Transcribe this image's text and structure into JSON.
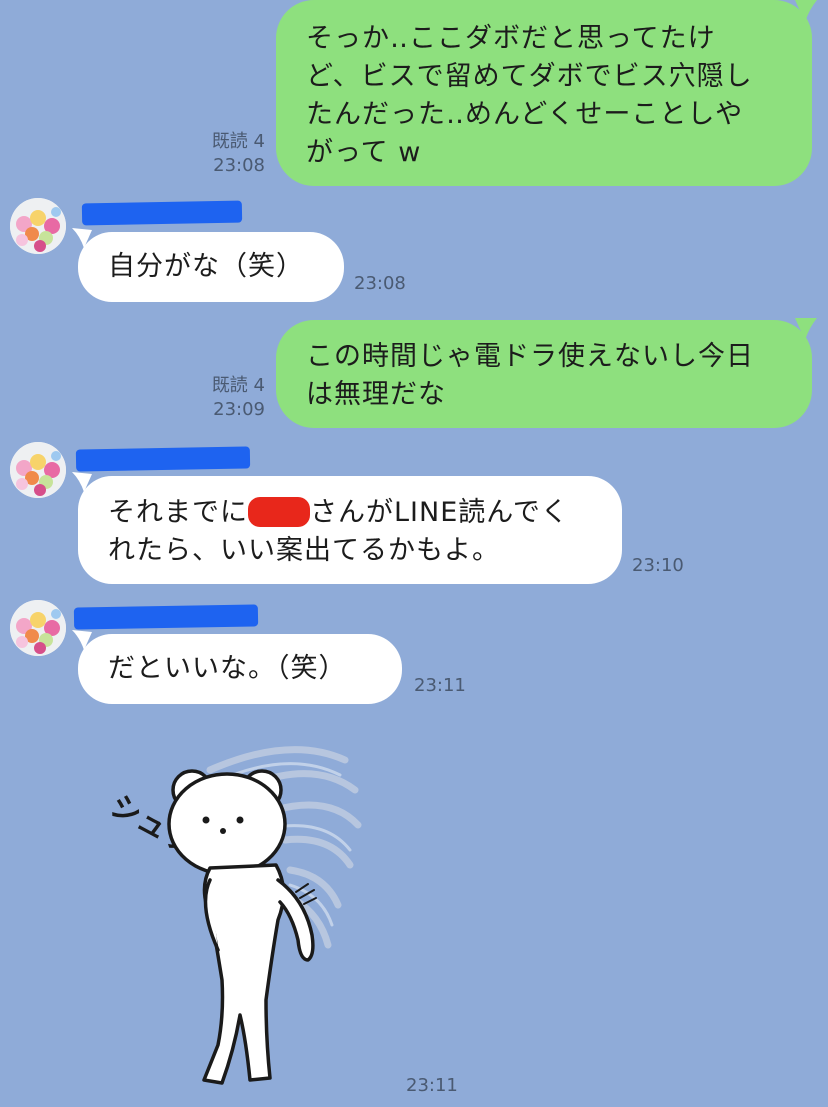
{
  "chat": {
    "messages": [
      {
        "side": "out",
        "lines": [
          "そっか‥ここダボだと思ってたけ",
          "ど、ビスで留めてダボでビス穴隠し",
          "たんだった‥めんどくせーことしや",
          "がって w"
        ],
        "read": "既読 4",
        "time": "23:08"
      },
      {
        "side": "in",
        "text": "自分がな（笑）",
        "time": "23:08"
      },
      {
        "side": "out",
        "lines": [
          "この時間じゃ電ドラ使えないし今日",
          "は無理だな"
        ],
        "read": "既読 4",
        "time": "23:09"
      },
      {
        "side": "in",
        "line1_before": "それまでに",
        "line1_after": "さんがLINE読んでく",
        "line2": "れたら、いい案出てるかもよ。",
        "time": "23:10"
      },
      {
        "side": "in",
        "text": "だといいな。（笑）",
        "time": "23:11"
      },
      {
        "side": "in",
        "type": "sticker",
        "sticker_text": "シュッ",
        "time": "23:11"
      }
    ]
  },
  "colors": {
    "background": "#8fabd8",
    "outgoing_bubble": "#8ee07e",
    "incoming_bubble": "#ffffff",
    "redaction_name": "#1e63f0",
    "redaction_inline": "#e8271b"
  },
  "icons": {
    "avatar": "flower-bouquet-avatar",
    "sticker": "white-bear-sticker"
  }
}
